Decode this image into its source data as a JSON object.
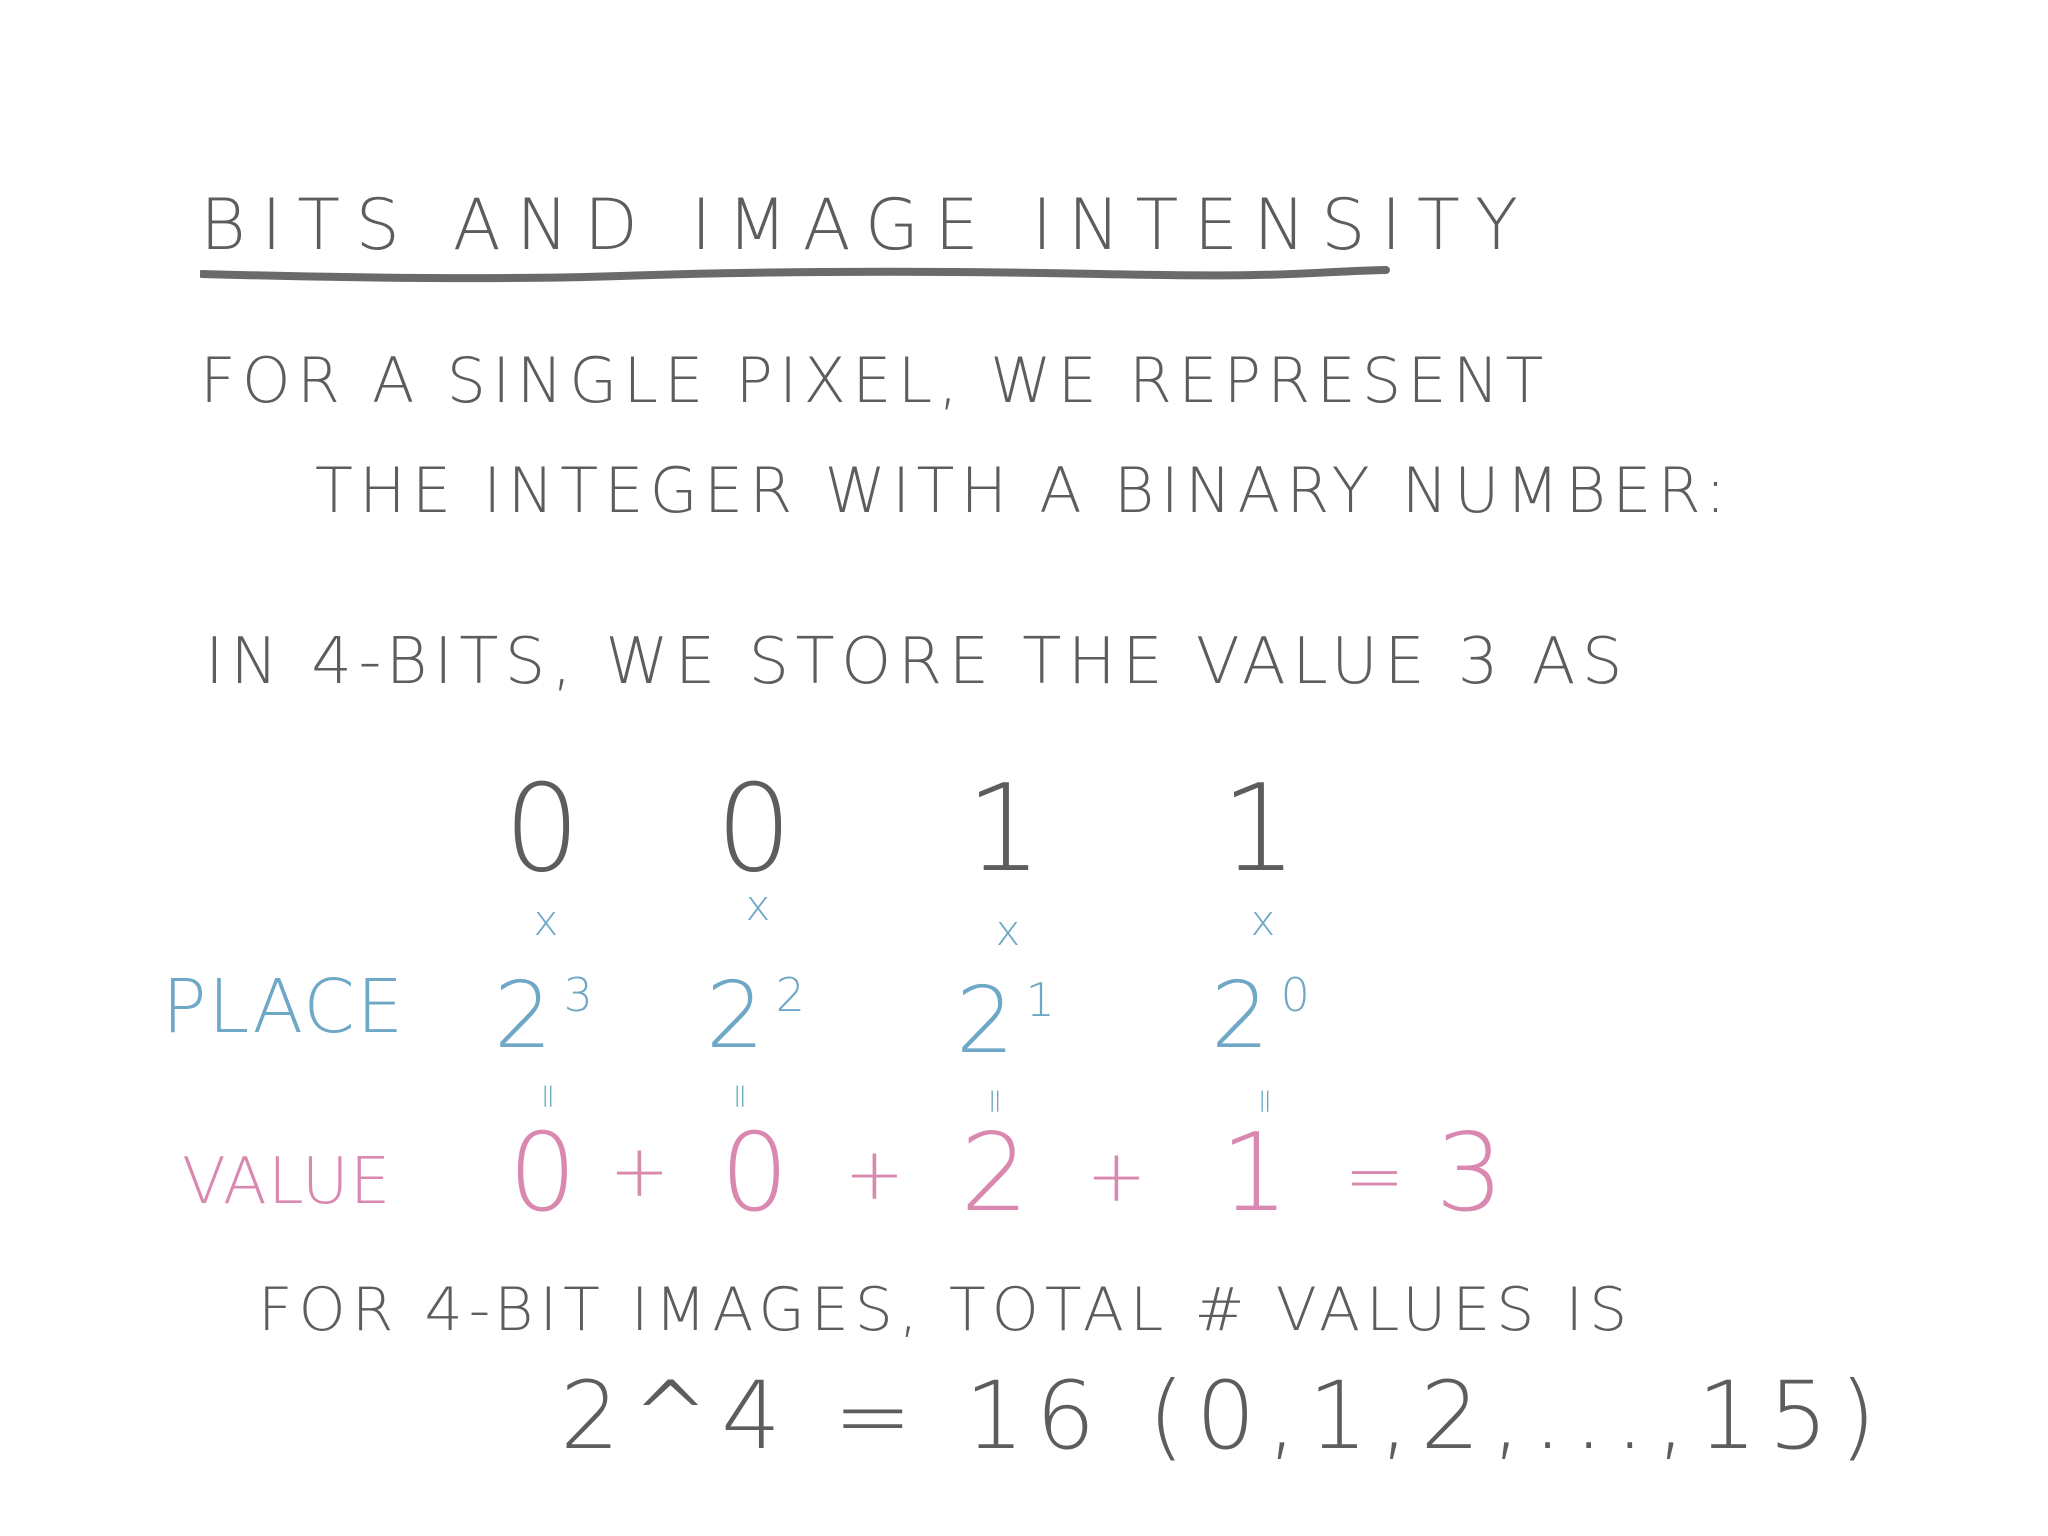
{
  "title": "BITS AND IMAGE INTENSITY",
  "intro": {
    "line1": "FOR A SINGLE PIXEL, WE REPRESENT",
    "line2": "THE INTEGER WITH A BINARY NUMBER:"
  },
  "statement": "IN 4-BITS, WE STORE THE VALUE 3 AS",
  "bits": [
    "0",
    "0",
    "1",
    "1"
  ],
  "multiply_symbol": "x",
  "equals_symbol": "=",
  "place_label": "PLACE",
  "places": [
    {
      "base": "2",
      "exp": "3"
    },
    {
      "base": "2",
      "exp": "2"
    },
    {
      "base": "2",
      "exp": "1"
    },
    {
      "base": "2",
      "exp": "0"
    }
  ],
  "value_label": "VALUE",
  "values": [
    "0",
    "0",
    "2",
    "1"
  ],
  "plus_symbol": "+",
  "sum_symbol": "=",
  "total": "3",
  "footer": {
    "line1": "FOR 4-BIT IMAGES, TOTAL # VALUES IS",
    "line2": "2^4 = 16 (0,1,2,...,15)"
  },
  "colors": {
    "ink": "#5d5d5d",
    "place": "#6fa8c6",
    "value": "#d989b0",
    "background": "#ffffff"
  }
}
